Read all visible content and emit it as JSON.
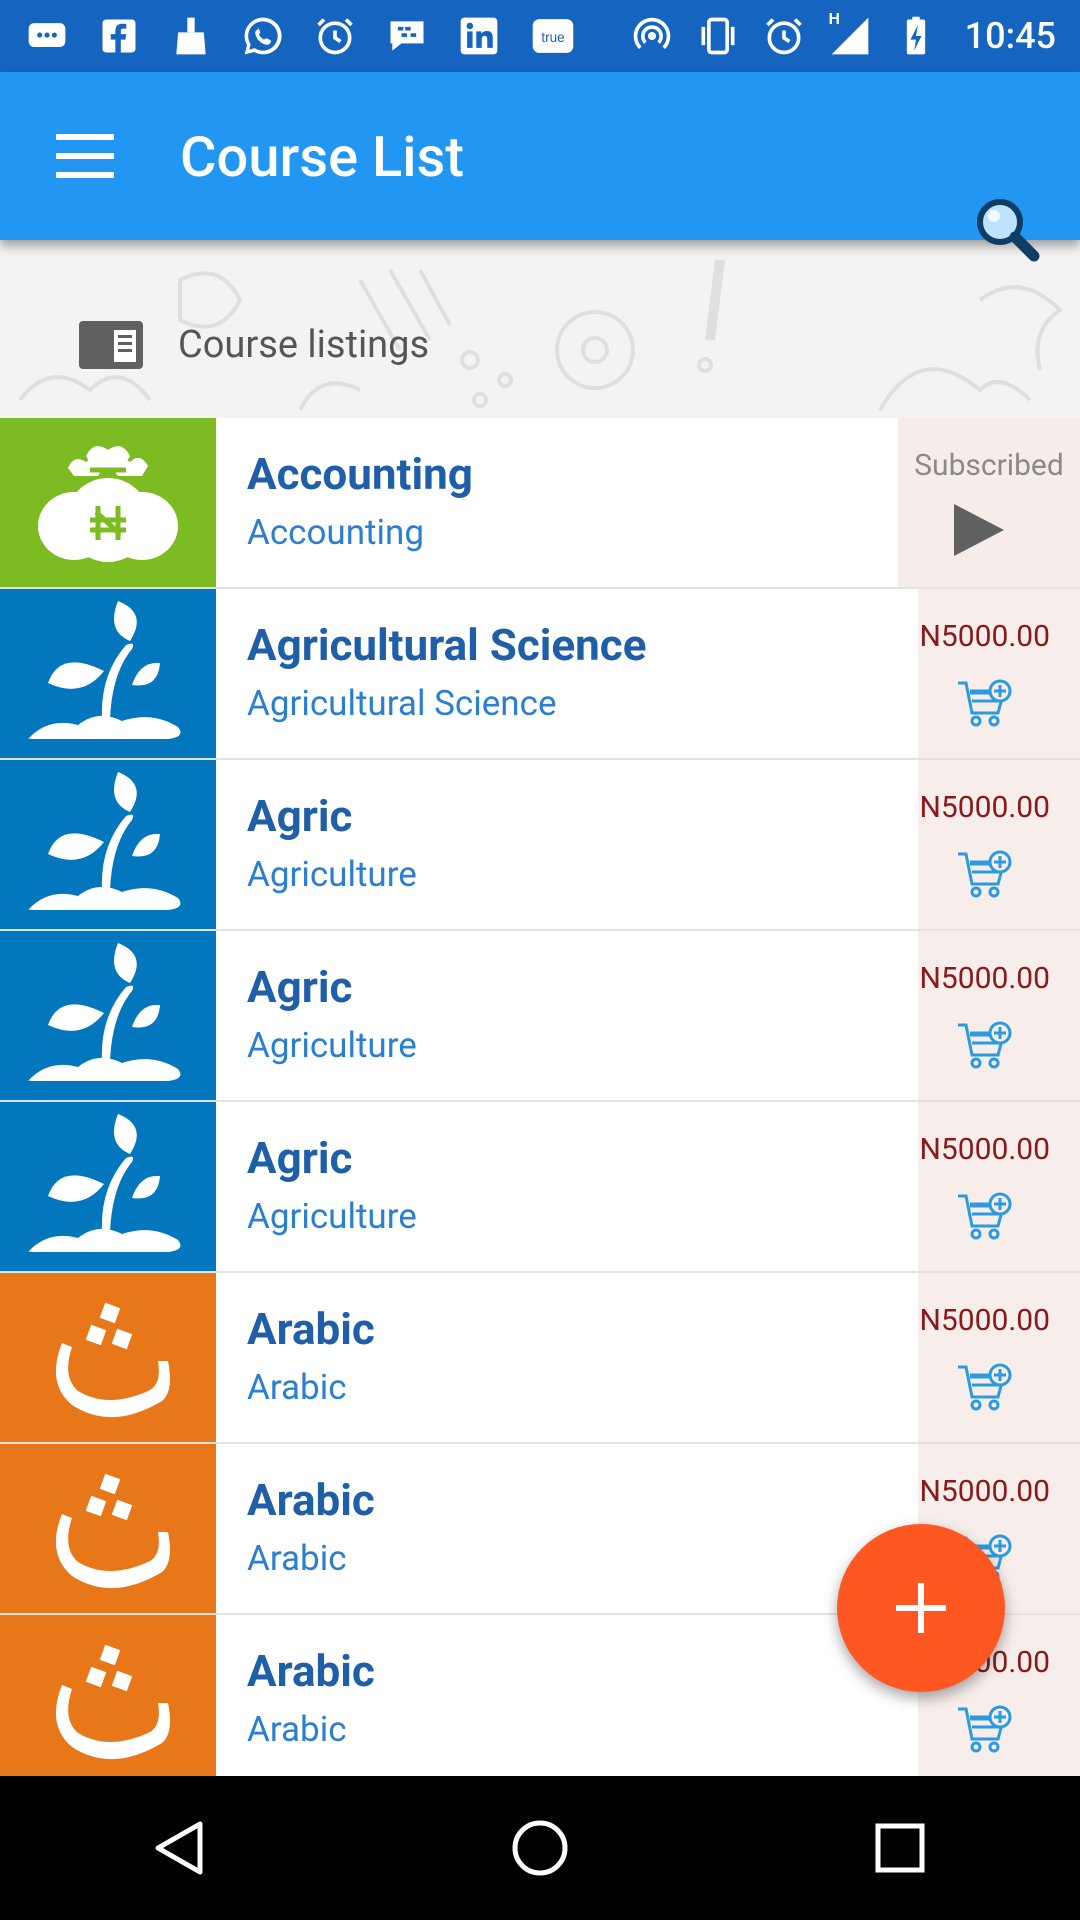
{
  "status_bar": {
    "time": "10:45",
    "network_label": "H",
    "true_label": "true",
    "icons": [
      "message-icon",
      "facebook-icon",
      "cleaner-icon",
      "whatsapp-icon",
      "alarm-icon",
      "bbm-icon",
      "linkedin-icon",
      "true-icon",
      "hotspot-icon",
      "vibrate-icon",
      "alarm-icon",
      "signal-icon",
      "battery-charging-icon"
    ]
  },
  "app_bar": {
    "title": "Course List",
    "menu_icon": "hamburger-menu-icon",
    "search_icon": "search-icon",
    "color": "#2196f3"
  },
  "section": {
    "title": "Course listings",
    "icon": "list-icon"
  },
  "courses": [
    {
      "name": "Accounting",
      "subtitle": "Accounting",
      "thumb_color": "#7cbb22",
      "thumb_icon": "money-bags-icon",
      "status": "Subscribed"
    },
    {
      "name": "Agricultural Science",
      "subtitle": "Agricultural Science",
      "thumb_color": "#0277bd",
      "thumb_icon": "plant-icon",
      "price": "N5000.00"
    },
    {
      "name": "Agric",
      "subtitle": "Agriculture",
      "thumb_color": "#0277bd",
      "thumb_icon": "plant-icon",
      "price": "N5000.00"
    },
    {
      "name": "Agric",
      "subtitle": "Agriculture",
      "thumb_color": "#0277bd",
      "thumb_icon": "plant-icon",
      "price": "N5000.00"
    },
    {
      "name": "Agric",
      "subtitle": "Agriculture",
      "thumb_color": "#0277bd",
      "thumb_icon": "plant-icon",
      "price": "N5000.00"
    },
    {
      "name": "Arabic",
      "subtitle": "Arabic",
      "thumb_color": "#e8771a",
      "thumb_icon": "arabic-letter-icon",
      "price": "N5000.00"
    },
    {
      "name": "Arabic",
      "subtitle": "Arabic",
      "thumb_color": "#e8771a",
      "thumb_icon": "arabic-letter-icon",
      "price": "N5000.00"
    },
    {
      "name": "Arabic",
      "subtitle": "Arabic",
      "thumb_color": "#e8771a",
      "thumb_icon": "arabic-letter-icon",
      "price": "N5000.00"
    }
  ],
  "fab": {
    "icon": "plus-icon",
    "color": "#ff5722"
  },
  "nav": {
    "icons": [
      "back-icon",
      "home-icon",
      "recents-icon"
    ]
  },
  "colors": {
    "title_text": "#1e5fa8",
    "subtitle_text": "#2b7fd1",
    "price_text": "#8a1a1a"
  }
}
